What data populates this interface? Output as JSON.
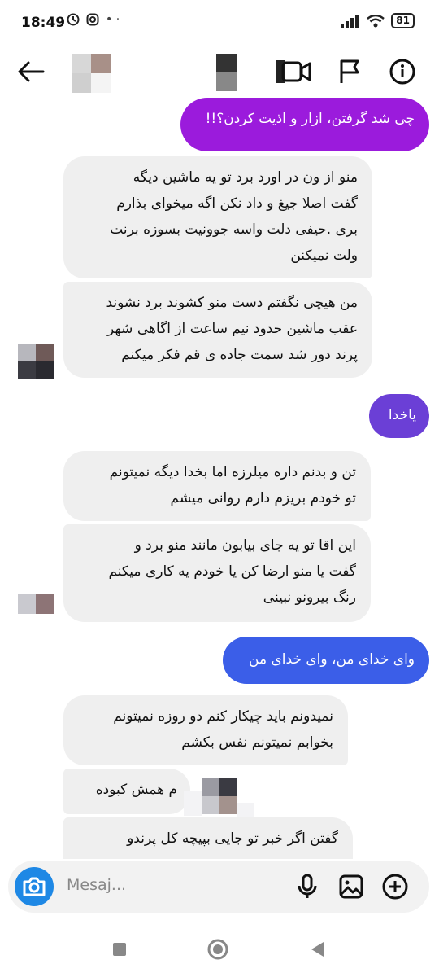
{
  "status": {
    "time": "18:49",
    "battery": "81"
  },
  "header": {
    "back_icon": "back-arrow-icon",
    "video_icon": "video-call-icon",
    "flag_icon": "flag-icon",
    "info_icon": "info-icon"
  },
  "messages": [
    {
      "dir": "out",
      "text": "چی شد گرفتن، ازار و اذیت کردن؟!!",
      "color": "#9b1bdc"
    },
    {
      "dir": "in",
      "text": "منو از ون در اورد برد تو یه ماشین دیگه\nگفت اصلا جیغ و داد نکن اگه میخوای بذارم\nبری .حیفی دلت واسه جوونیت بسوزه برنت\nولت نمیکنن"
    },
    {
      "dir": "in",
      "text": "من هیچی نگفتم دست منو کشوند برد نشوند\nعقب ماشین حدود نیم ساعت از اگاهی شهر\nپرند دور شد سمت جاده ی قم فکر میکنم"
    },
    {
      "dir": "out",
      "text": "یاخدا",
      "color": "#6b3fd6"
    },
    {
      "dir": "in",
      "text": "تن و بدنم داره میلرزه اما بخدا دیگه نمیتونم\nتو خودم بریزم دارم روانی میشم"
    },
    {
      "dir": "in",
      "text": "این اقا تو یه جای بیابون مانند منو برد و\nگفت یا منو ارضا کن یا خودم یه کاری میکنم\nرنگ بیرونو نبینی"
    },
    {
      "dir": "out",
      "text": "وای خدای من، وای خدای من",
      "color": "#3b5ee8"
    },
    {
      "dir": "in",
      "text": "نمیدونم باید چیکار کنم دو روزه نمیتونم\nبخوابم نمیتونم نفس بکشم"
    },
    {
      "dir": "in",
      "text": "م همش کبوده"
    },
    {
      "dir": "in",
      "text": "گفتن اگر خبر تو جایی بپیچه کل پرندو"
    }
  ],
  "composer": {
    "placeholder": "Mesaj...",
    "camera_icon": "camera-icon",
    "mic_icon": "microphone-icon",
    "gallery_icon": "gallery-icon",
    "add_icon": "plus-circle-icon",
    "accent": "#1e88e5"
  },
  "navbar": {
    "recents_icon": "recents-square-icon",
    "home_icon": "home-circle-icon",
    "back_icon": "back-triangle-icon"
  }
}
